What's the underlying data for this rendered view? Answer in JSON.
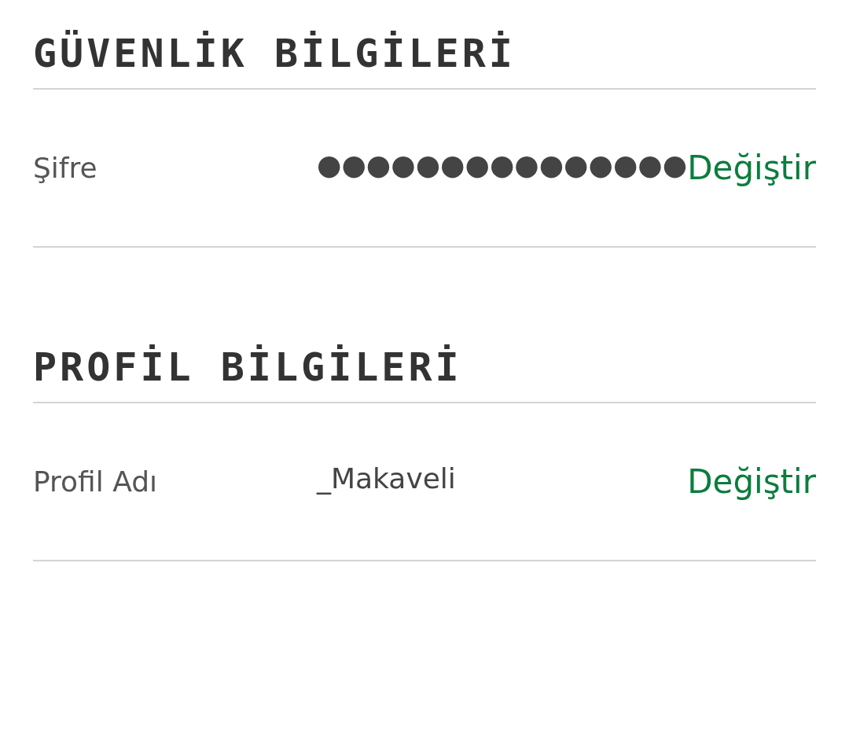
{
  "sections": [
    {
      "title": "GÜVENLİK BİLGİLERİ",
      "rows": [
        {
          "label": "Şifre",
          "value": "●●●●●●●●●●●●●●●",
          "action": "Değiştir"
        }
      ]
    },
    {
      "title": "PROFİL BİLGİLERİ",
      "rows": [
        {
          "label": "Profil Adı",
          "value": "_Makaveli",
          "action": "Değiştir"
        }
      ]
    }
  ]
}
